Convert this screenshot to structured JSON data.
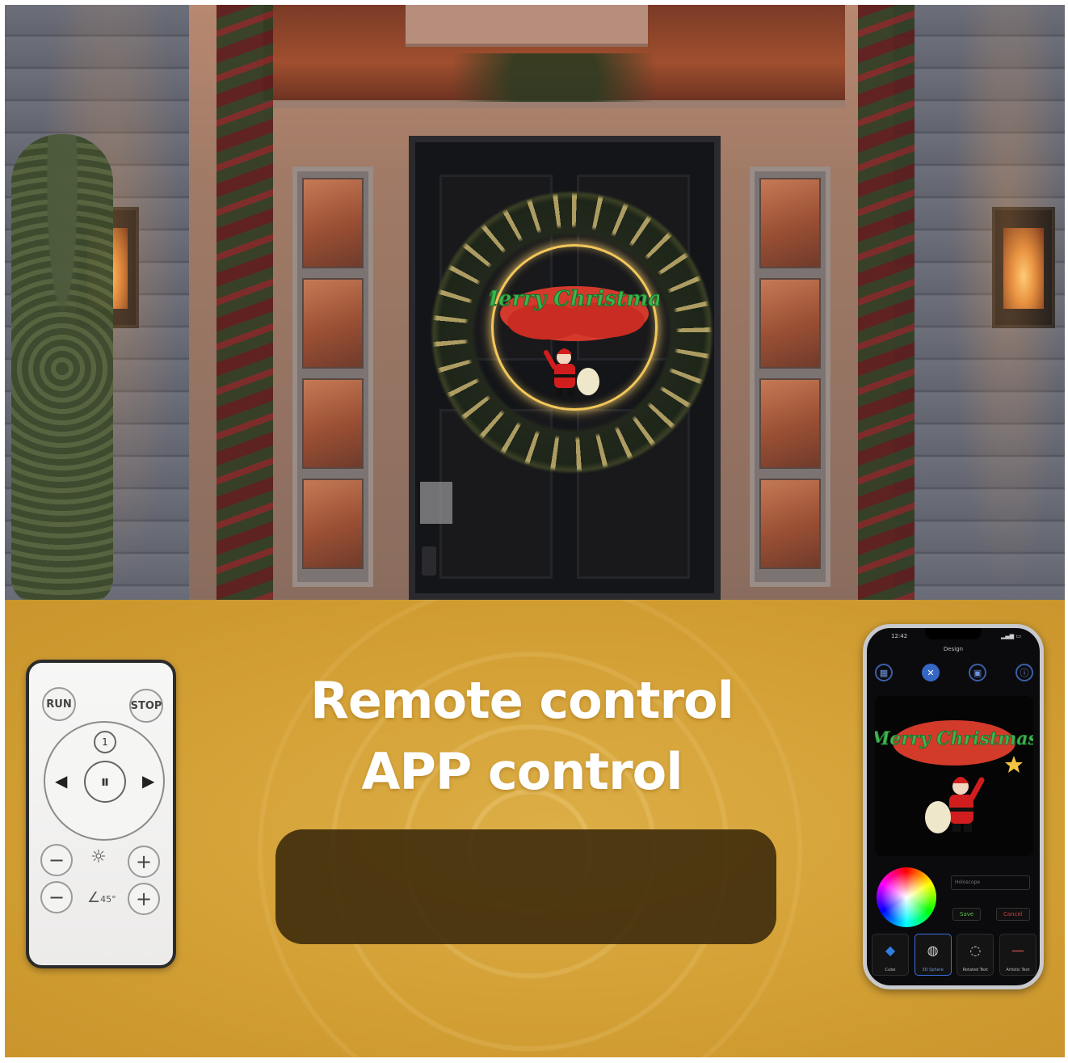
{
  "headline": {
    "line1": "Remote control",
    "line2": "APP control"
  },
  "door_scene": {
    "wreath_sign_text": "Merry Christmas"
  },
  "remote": {
    "run_label": "RUN",
    "stop_label": "STOP",
    "mode_label": "1",
    "play_pause_symbol": "⏸",
    "left_symbol": "◀",
    "right_symbol": "▶",
    "minus_symbol": "−",
    "plus_symbol": "+",
    "brightness_icon": "brightness-icon",
    "angle_label": "45°"
  },
  "phone": {
    "time": "12:42",
    "app_title": "Design",
    "nav_icons": [
      "grid-icon",
      "design-icon",
      "image-icon",
      "info-icon"
    ],
    "preview_text": "Merry Christmas",
    "input_placeholder": "Holoscope",
    "save_label": "Save",
    "cancel_label": "Cancel",
    "tiles": [
      {
        "label": "Cube"
      },
      {
        "label": "3D Sphere"
      },
      {
        "label": "Rotated Text"
      },
      {
        "label": "Artistic Text"
      }
    ],
    "colors": {
      "accent": "#3567c4",
      "save": "#5fbf4b",
      "cancel": "#d04040"
    }
  }
}
